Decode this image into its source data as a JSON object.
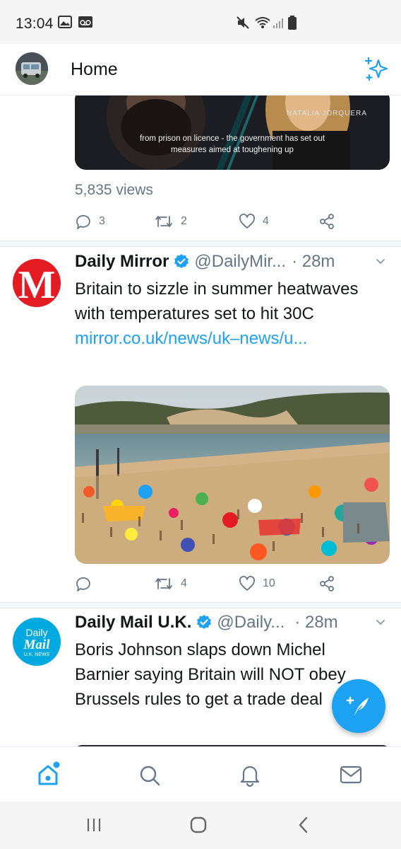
{
  "status_bar": {
    "time": "13:04"
  },
  "header": {
    "title": "Home"
  },
  "previous_tweet": {
    "caption_line1": "from prison on licence - the government has set out",
    "caption_line2": "measures aimed at toughening up",
    "lower_third": "NATALIA JORQUERA",
    "views": "5,835 views",
    "reply_count": "3",
    "retweet_count": "2",
    "like_count": "4"
  },
  "tweets": [
    {
      "name": "Daily Mirror",
      "handle": "@DailyMir...",
      "time": "· 28m",
      "text": "Britain to sizzle in summer heatwaves with temperatures set to hit 30C ",
      "link": "mirror.co.uk/news/uk–news/u...",
      "reply_count": "",
      "retweet_count": "4",
      "like_count": "10"
    },
    {
      "name": "Daily Mail U.K.",
      "handle": "@Daily...",
      "time": "· 28m",
      "text": "Boris Johnson slaps down Michel Barnier saying Britain will NOT obey Brussels rules to get a trade deal",
      "avatar_text": {
        "line1": "Daily",
        "line2": "Mail",
        "line3": "U.K. NEWS"
      }
    }
  ],
  "mirror_logo_letter": "M",
  "icons": {
    "sparkle": "sparkle-icon",
    "compose": "compose-icon",
    "nav": [
      "home-icon",
      "search-icon",
      "notifications-icon",
      "messages-icon"
    ],
    "system": [
      "recents-icon",
      "home-button-icon",
      "back-icon"
    ]
  },
  "colors": {
    "accent": "#1da1f2",
    "secondary_text": "#657786",
    "mirror_red": "#e51b24",
    "mail_blue": "#00a9e0"
  }
}
